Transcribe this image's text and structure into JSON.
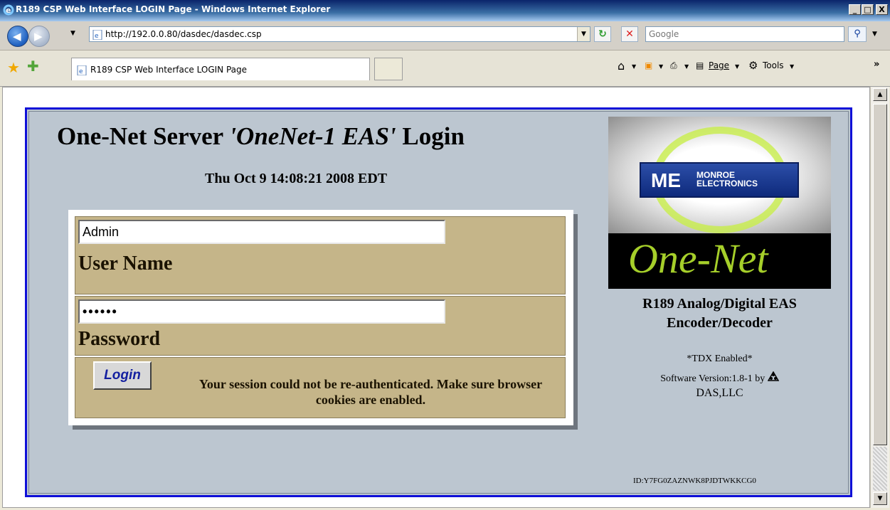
{
  "window": {
    "title": "R189 CSP Web Interface LOGIN Page - Windows Internet Explorer",
    "minimize": "_",
    "maximize": "□",
    "close": "X"
  },
  "address_bar": {
    "url": "http://192.0.0.80/dasdec/dasdec.csp",
    "search_placeholder": "Google"
  },
  "tab": {
    "title": "R189 CSP Web Interface LOGIN Page"
  },
  "command_bar": {
    "page": "Page",
    "tools": "Tools"
  },
  "page": {
    "heading_prefix": "One-Net Server ",
    "heading_name": "'OneNet-1 EAS'",
    "heading_suffix": " Login",
    "datetime": "Thu Oct 9 14:08:21 2008 EDT",
    "username_value": "Admin",
    "username_label": "User Name",
    "password_value": "••••••",
    "password_label": "Password",
    "login_button": "Login",
    "message": "Your session could not be re-authenticated. Make sure browser cookies are enabled.",
    "logo_company_abbr": "ME",
    "logo_company_line1": "MONROE",
    "logo_company_line2": "ELECTRONICS",
    "logo_wordmark": "One-Net",
    "product_line1": "R189 Analog/Digital EAS",
    "product_line2": "Encoder/Decoder",
    "tdx": "*TDX Enabled*",
    "software_version": "Software Version:1.8-1  by",
    "vendor": "DAS,LLC",
    "device_id": "ID:Y7FG0ZAZNWK8PJDTWKKCG0"
  }
}
